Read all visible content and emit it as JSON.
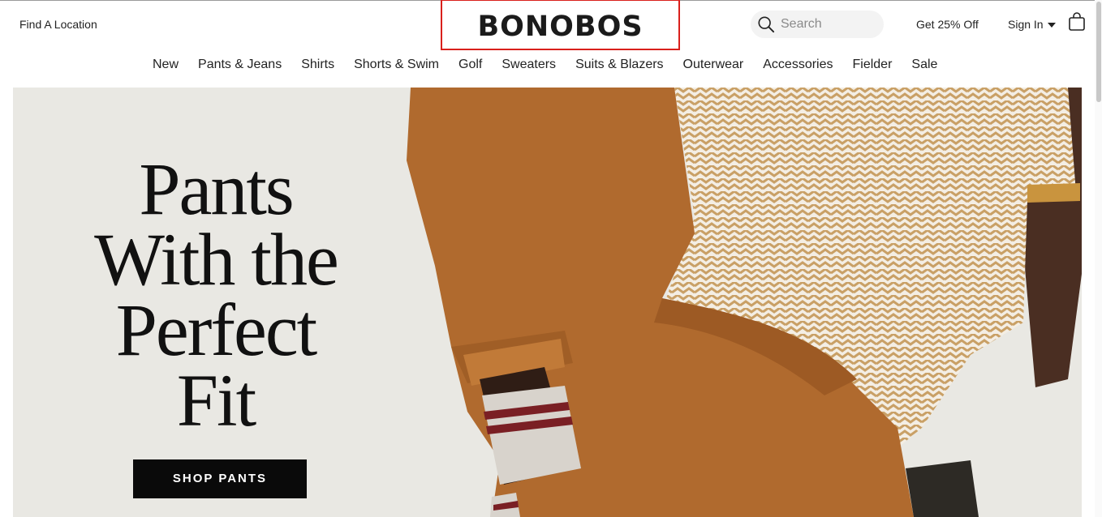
{
  "header": {
    "find_location": "Find A Location",
    "logo": "BONOBOS",
    "search_placeholder": "Search",
    "promo": "Get 25% Off",
    "sign_in": "Sign In"
  },
  "nav": {
    "items": [
      "New",
      "Pants & Jeans",
      "Shirts",
      "Shorts & Swim",
      "Golf",
      "Sweaters",
      "Suits & Blazers",
      "Outerwear",
      "Accessories",
      "Fielder",
      "Sale"
    ]
  },
  "hero": {
    "heading_lines": [
      "Pants",
      "With the",
      "Perfect",
      "Fit"
    ],
    "cta": "SHOP PANTS"
  },
  "colors": {
    "highlight_border": "#d9201c",
    "hero_bg": "#e9e8e3",
    "pants": "#b06a2e",
    "cta_bg": "#0a0a0a"
  }
}
